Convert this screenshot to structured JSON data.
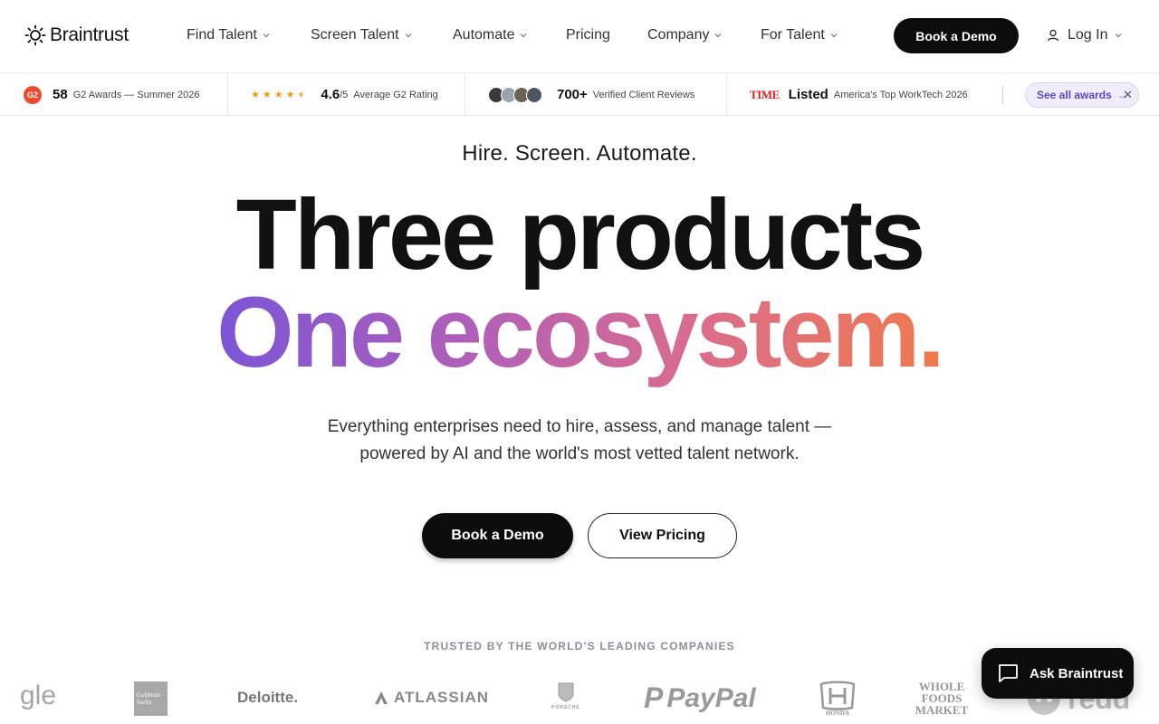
{
  "brand": {
    "name": "Braintrust"
  },
  "nav": {
    "items": [
      {
        "label": "Find Talent",
        "has_dropdown": true
      },
      {
        "label": "Screen Talent",
        "has_dropdown": true
      },
      {
        "label": "Automate",
        "has_dropdown": true
      },
      {
        "label": "Pricing",
        "has_dropdown": false
      },
      {
        "label": "Company",
        "has_dropdown": true
      },
      {
        "label": "For Talent",
        "has_dropdown": true
      }
    ],
    "book_demo": "Book a Demo",
    "login": "Log In"
  },
  "awards": {
    "g2_count": "58",
    "g2_label": "G2 Awards — Summer 2026",
    "rating_value": "4.6",
    "rating_scale": "/5",
    "rating_label": "Average G2 Rating",
    "rating_stars": 4.5,
    "reviews_count": "700+",
    "reviews_label": "Verified Client Reviews",
    "time_logo": "TIME",
    "time_status": "Listed",
    "time_label": "America's Top WorkTech 2026",
    "see_all": "See all awards"
  },
  "hero": {
    "eyebrow": "Hire. Screen. Automate.",
    "headline_line1": "Three products",
    "headline_line2": "One ecosystem.",
    "subtitle": "Everything enterprises need to hire, assess, and manage talent — powered by AI and the world's most vetted talent network.",
    "primary_cta": "Book a Demo",
    "secondary_cta": "View Pricing"
  },
  "trusted": {
    "heading": "TRUSTED BY THE WORLD'S LEADING COMPANIES",
    "logos": [
      "gle",
      "Goldman Sachs",
      "Deloitte.",
      "ATLASSIAN",
      "PORSCHE",
      "PayPal",
      "HONDA",
      "WHOLE FOODS MARKET",
      "redd"
    ]
  },
  "assistant": {
    "label": "Ask Braintrust"
  },
  "colors": {
    "accent_dark": "#0c0c0c",
    "gradient_start": "#7b55d6",
    "gradient_end": "#f07a4d",
    "g2_red": "#ef4a2f",
    "star": "#f59e0b",
    "awards_pill": "#5a46c4"
  }
}
